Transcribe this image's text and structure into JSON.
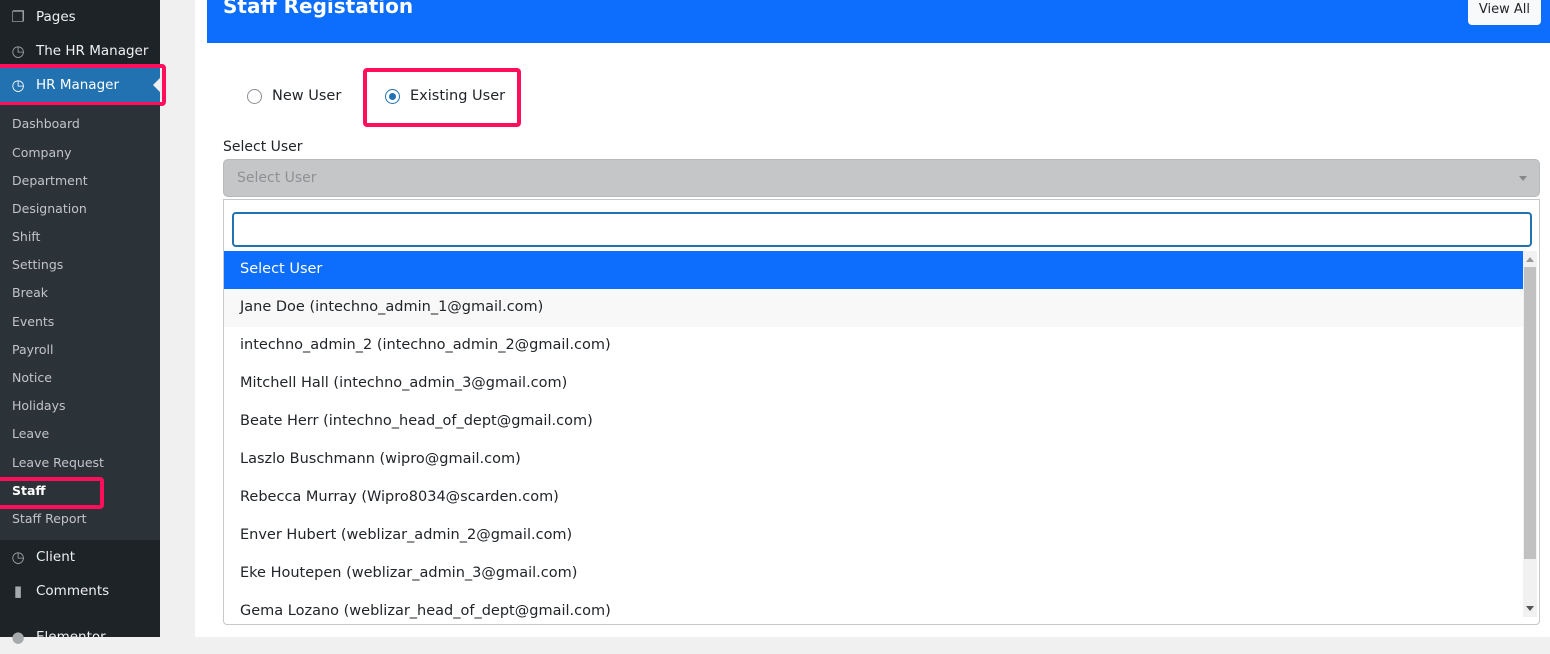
{
  "sidebar": {
    "top": [
      {
        "label": "Pages",
        "icon": "pages-icon"
      },
      {
        "label": "The HR Manager",
        "icon": "clock-icon"
      },
      {
        "label": "HR Manager",
        "icon": "clock-icon"
      }
    ],
    "submenu": [
      "Dashboard",
      "Company",
      "Department",
      "Designation",
      "Shift",
      "Settings",
      "Break",
      "Events",
      "Payroll",
      "Notice",
      "Holidays",
      "Leave",
      "Leave Request",
      "Staff",
      "Staff Report"
    ],
    "bottom": [
      {
        "label": "Client",
        "icon": "clock-icon"
      },
      {
        "label": "Comments",
        "icon": "comment-icon"
      },
      {
        "label": "Elementor",
        "icon": "elementor-icon"
      }
    ]
  },
  "header": {
    "title": "Staff Registation",
    "view_all": "View All"
  },
  "radios": {
    "new_user": "New User",
    "existing_user": "Existing User",
    "selected": "existing_user"
  },
  "select": {
    "label": "Select User",
    "placeholder": "Select User"
  },
  "dropdown": {
    "search_value": "",
    "options": [
      "Select User",
      "Jane Doe (intechno_admin_1@gmail.com)",
      "intechno_admin_2 (intechno_admin_2@gmail.com)",
      "Mitchell Hall (intechno_admin_3@gmail.com)",
      "Beate Herr (intechno_head_of_dept@gmail.com)",
      "Laszlo Buschmann (wipro@gmail.com)",
      "Rebecca Murray (Wipro8034@scarden.com)",
      "Enver Hubert (weblizar_admin_2@gmail.com)",
      "Eke Houtepen (weblizar_admin_3@gmail.com)",
      "Gema Lozano (weblizar_head_of_dept@gmail.com)"
    ]
  },
  "colors": {
    "accent": "#0d6efd",
    "highlight": "#ff0f5b",
    "wp_blue": "#2271b1"
  }
}
